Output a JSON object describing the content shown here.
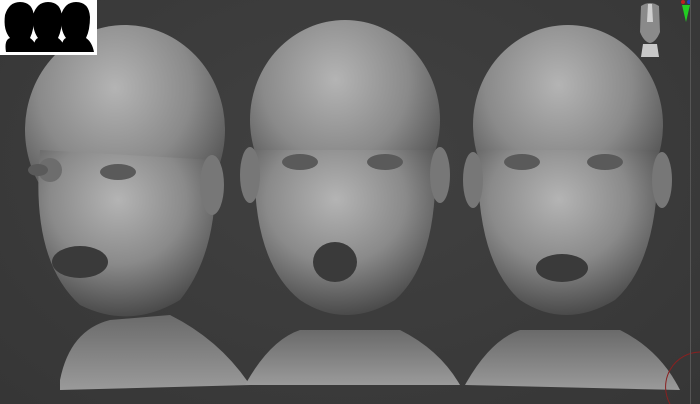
{
  "canvas": {
    "background": "#3b3b3b"
  },
  "thumbnail": {
    "icon": "head-silhouettes-icon",
    "count": 3
  },
  "navigation": {
    "icon": "head-orientation-gizmo-icon",
    "axis_color": "#22cc22"
  },
  "models": [
    {
      "name": "head-left-expression"
    },
    {
      "name": "head-center-expression"
    },
    {
      "name": "head-right-expression"
    }
  ]
}
